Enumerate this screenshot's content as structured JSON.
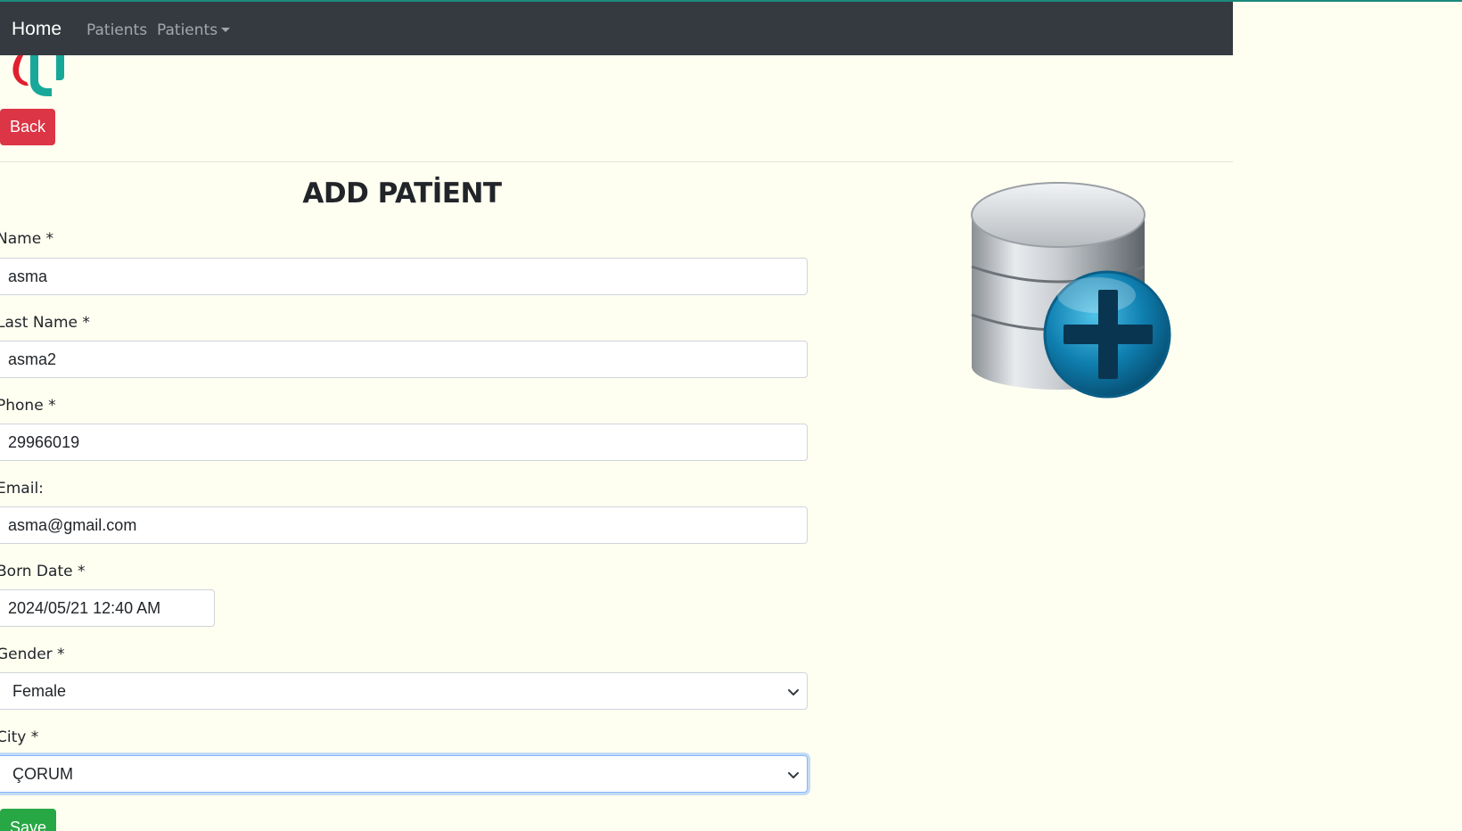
{
  "navbar": {
    "brand": "Home",
    "links": [
      {
        "label": "Patients"
      },
      {
        "label": "Patients",
        "has_dropdown": true
      }
    ]
  },
  "actions": {
    "back_label": "Back",
    "save_label": "Save"
  },
  "form": {
    "title": "ADD PATİENT",
    "fields": {
      "name": {
        "label": "Name *",
        "value": "asma"
      },
      "last_name": {
        "label": "Last Name *",
        "value": "asma2"
      },
      "phone": {
        "label": "Phone *",
        "value": "29966019"
      },
      "email": {
        "label": "Email:",
        "value": "asma@gmail.com"
      },
      "born_date": {
        "label": "Born Date *",
        "value": "2024/05/21 12:40 AM"
      },
      "gender": {
        "label": "Gender *",
        "value": "Female"
      },
      "city": {
        "label": "City *",
        "value": "ÇORUM"
      }
    }
  },
  "icons": {
    "logo": "clinic-logo",
    "illustration": "database-add-icon"
  },
  "colors": {
    "navbar_bg": "#343a40",
    "page_bg": "#fffff1",
    "back_button": "#dc3545",
    "save_button": "#28a745",
    "top_accent": "#1b8a7d"
  }
}
